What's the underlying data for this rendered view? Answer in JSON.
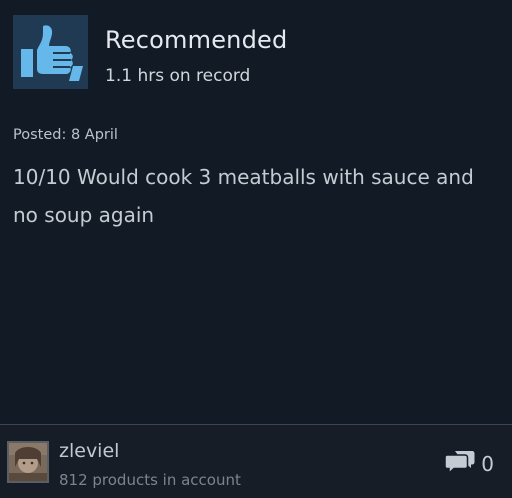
{
  "review": {
    "verdict": "Recommended",
    "hours": "1.1 hrs on record",
    "posted": "Posted: 8 April",
    "text": "10/10 Would cook 3 meatballs with sauce and no soup again",
    "icon": "thumbs-up-icon"
  },
  "author": {
    "name": "zleviel",
    "products": "812 products in account"
  },
  "comments": {
    "count": "0",
    "icon": "comment-bubbles-icon"
  },
  "colors": {
    "background": "#121a25",
    "footer": "#161d27",
    "thumb_bg": "#1f3a52",
    "thumb_fg": "#66b8ea"
  }
}
